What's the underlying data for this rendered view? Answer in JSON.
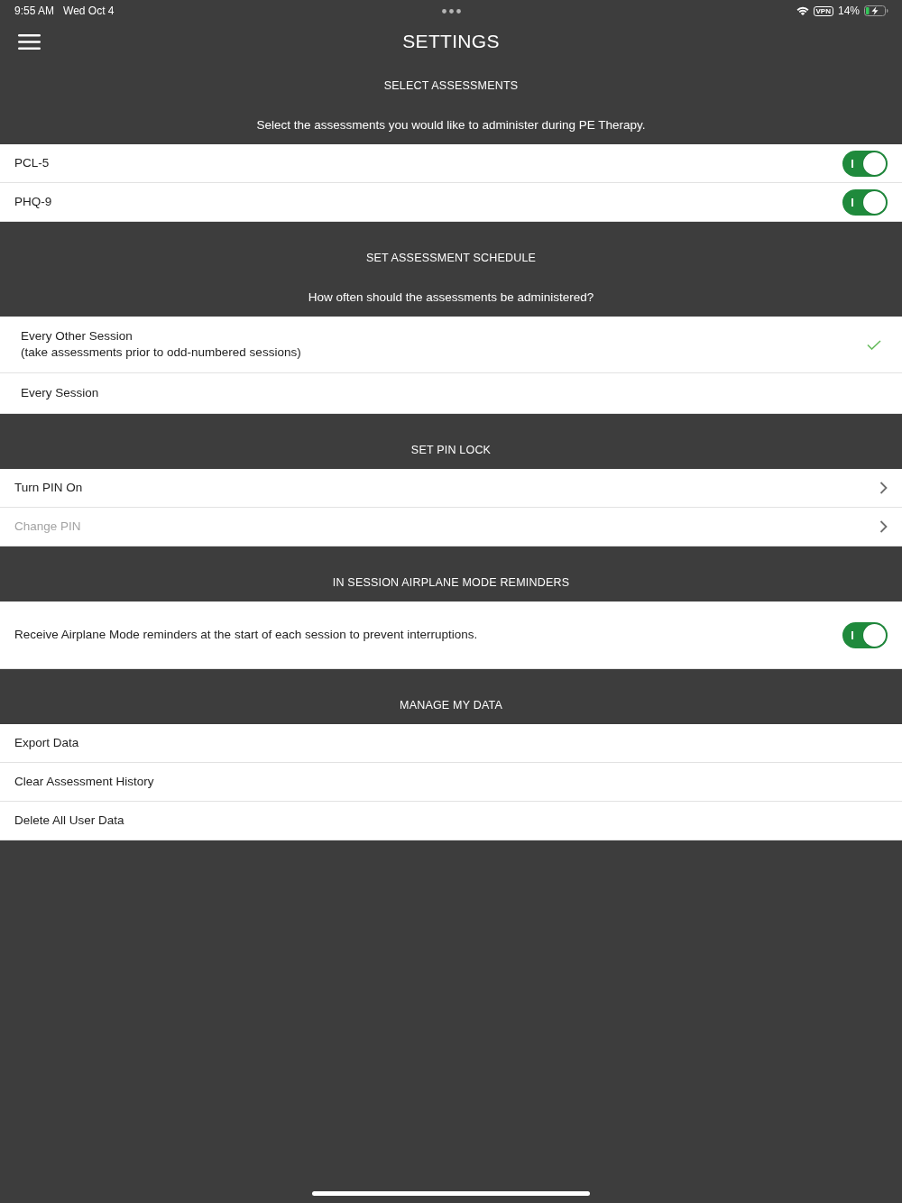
{
  "status_bar": {
    "time": "9:55 AM",
    "date": "Wed Oct 4",
    "vpn": "VPN",
    "battery": "14%"
  },
  "header": {
    "title": "SETTINGS"
  },
  "sections": [
    {
      "title": "SELECT ASSESSMENTS",
      "description": "Select the assessments you would like to administer during PE Therapy.",
      "rows": [
        {
          "kind": "toggle",
          "label": "PCL-5",
          "on": true
        },
        {
          "kind": "toggle",
          "label": "PHQ-9",
          "on": true
        }
      ]
    },
    {
      "title": "SET ASSESSMENT SCHEDULE",
      "description": "How often should the assessments be administered?",
      "rows": [
        {
          "kind": "option",
          "label": "Every Other Session",
          "note": "(take assessments prior to odd-numbered sessions)",
          "selected": true
        },
        {
          "kind": "option",
          "label": "Every Session",
          "selected": false
        }
      ]
    },
    {
      "title": "SET PIN LOCK",
      "rows": [
        {
          "kind": "link",
          "label": "Turn PIN On",
          "disabled": false
        },
        {
          "kind": "link",
          "label": "Change PIN",
          "disabled": true
        }
      ]
    },
    {
      "title": "IN SESSION AIRPLANE MODE REMINDERS",
      "rows": [
        {
          "kind": "reminder",
          "label": "Receive Airplane Mode reminders at the start of each session to prevent interruptions.",
          "on": true
        }
      ]
    },
    {
      "title": "MANAGE MY DATA",
      "rows": [
        {
          "kind": "action",
          "label": "Export Data"
        },
        {
          "kind": "action",
          "label": "Clear Assessment History"
        },
        {
          "kind": "action",
          "label": "Delete All User Data"
        }
      ]
    }
  ]
}
